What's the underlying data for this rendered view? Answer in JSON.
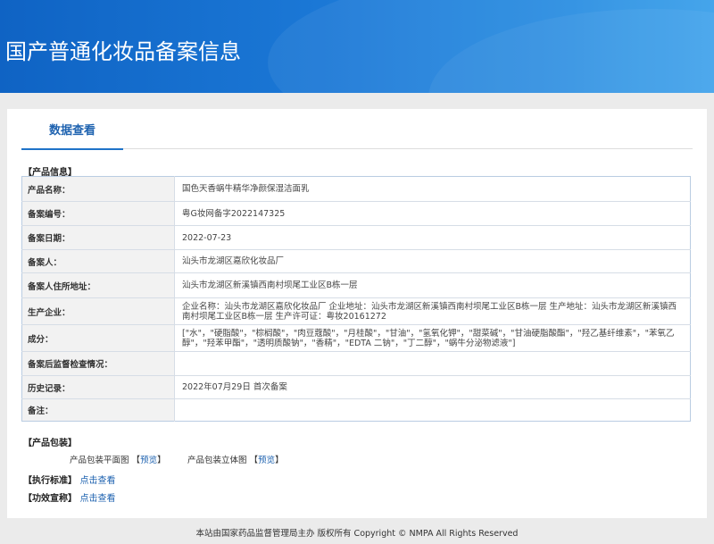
{
  "header": {
    "title": "国产普通化妆品备案信息"
  },
  "tabs": [
    {
      "label": "数据查看"
    }
  ],
  "product_info": {
    "section_label": "【产品信息】",
    "rows": [
      {
        "label": "产品名称：",
        "value": "国色天香蜗牛精华净颜保湿洁面乳"
      },
      {
        "label": "备案编号：",
        "value": "粤G妆网备字2022147325"
      },
      {
        "label": "备案日期：",
        "value": "2022-07-23"
      },
      {
        "label": "备案人：",
        "value": "汕头市龙湖区嘉欣化妆品厂"
      },
      {
        "label": "备案人住所地址：",
        "value": "汕头市龙湖区新溪镇西南村坝尾工业区B栋一层"
      },
      {
        "label": "生产企业：",
        "value": "企业名称：汕头市龙湖区嘉欣化妆品厂 企业地址：汕头市龙湖区新溪镇西南村坝尾工业区B栋一层 生产地址：汕头市龙湖区新溪镇西南村坝尾工业区B栋一层 生产许可证：粤妆20161272"
      },
      {
        "label": "成分：",
        "value": "[\"水\"，\"硬脂酸\"，\"棕榈酸\"，\"肉豆蔻酸\"，\"月桂酸\"，\"甘油\"，\"氢氧化钾\"，\"甜菜碱\"，\"甘油硬脂酸酯\"，\"羟乙基纤维素\"，\"苯氧乙醇\"，\"羟苯甲酯\"，\"透明质酸钠\"，\"香精\"，\"EDTA 二钠\"，\"丁二醇\"，\"蜗牛分泌物滤液\"]"
      },
      {
        "label": "备案后监督检查情况：",
        "value": ""
      },
      {
        "label": "历史记录：",
        "value": "2022年07月29日 首次备案"
      },
      {
        "label": "备注：",
        "value": ""
      }
    ]
  },
  "packaging": {
    "section_label": "【产品包装】",
    "flat_label": "产品包装平面图",
    "flat_link": "预览",
    "solid_label": "产品包装立体图",
    "solid_link": "预览",
    "bracket_open": "【",
    "bracket_close": "】"
  },
  "standard": {
    "section_label": "【执行标准】",
    "link": "点击查看"
  },
  "efficacy": {
    "section_label": "【功效宣称】",
    "link": "点击查看"
  },
  "footer": {
    "text": "本站由国家药品监督管理局主办 版权所有 Copyright © NMPA All Rights Reserved"
  }
}
